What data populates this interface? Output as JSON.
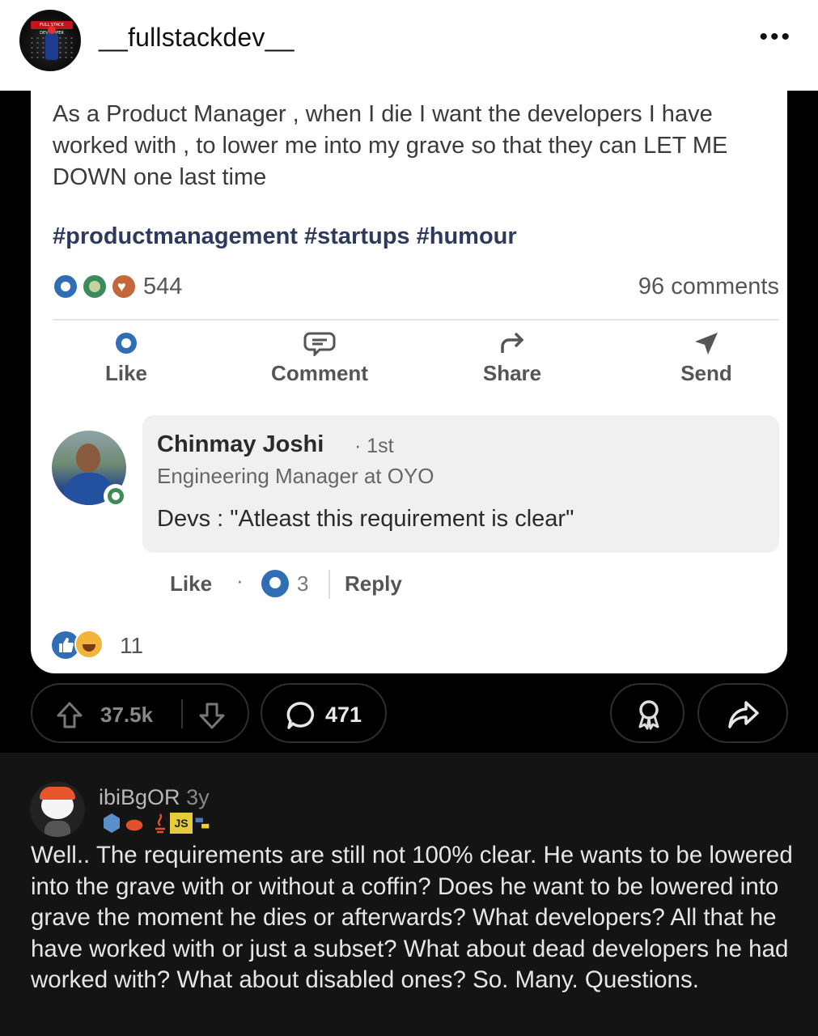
{
  "instagram": {
    "username": "__fullstackdev__",
    "avatar_tag": "FULL STACK DEVELOPER",
    "more_icon": "more-dots-icon",
    "more_label": "•••"
  },
  "linkedin_post": {
    "text": "As a Product Manager , when I die I want the developers I have worked with , to lower me into my grave so that they can LET ME DOWN one last time",
    "hashtags": "#productmanagement #startups #humour",
    "reaction_count": "544",
    "comments_count": "96 comments",
    "actions": [
      {
        "label": "Like",
        "icon": "like-icon"
      },
      {
        "label": "Comment",
        "icon": "comment-icon"
      },
      {
        "label": "Share",
        "icon": "share-arrow-icon"
      },
      {
        "label": "Send",
        "icon": "send-icon"
      }
    ],
    "comment": {
      "author": "Chinmay Joshi",
      "degree": "· 1st",
      "headline": "Engineering Manager at OYO",
      "text": "Devs : \"Atleast this requirement is clear\"",
      "like_label": "Like",
      "separator": "·",
      "reaction_count": "3",
      "reply_label": "Reply"
    },
    "bottom_reaction_count": "11"
  },
  "reddit_bar": {
    "vote_count": "37.5k",
    "comment_count": "471"
  },
  "reddit_comment": {
    "username": "ibiBgOR",
    "age": "3y",
    "flair_icons": [
      "c-icon",
      "rust-icon",
      "java-icon",
      "js-icon",
      "python-icon"
    ],
    "flair_js": "JS",
    "body": "Well.. The requirements are still not 100% clear. He wants to be lowered into the grave with or without a coffin? Does he want to be lowered into grave the moment he dies or afterwards? What developers? All that he have worked with or just a subset? What about dead developers he had worked with? What about disabled ones? So. Many. Questions."
  },
  "colors": {
    "linkedin_blue": "#2f6db5",
    "reddit_bg": "#141414",
    "hashtag": "#2e3a5c"
  }
}
